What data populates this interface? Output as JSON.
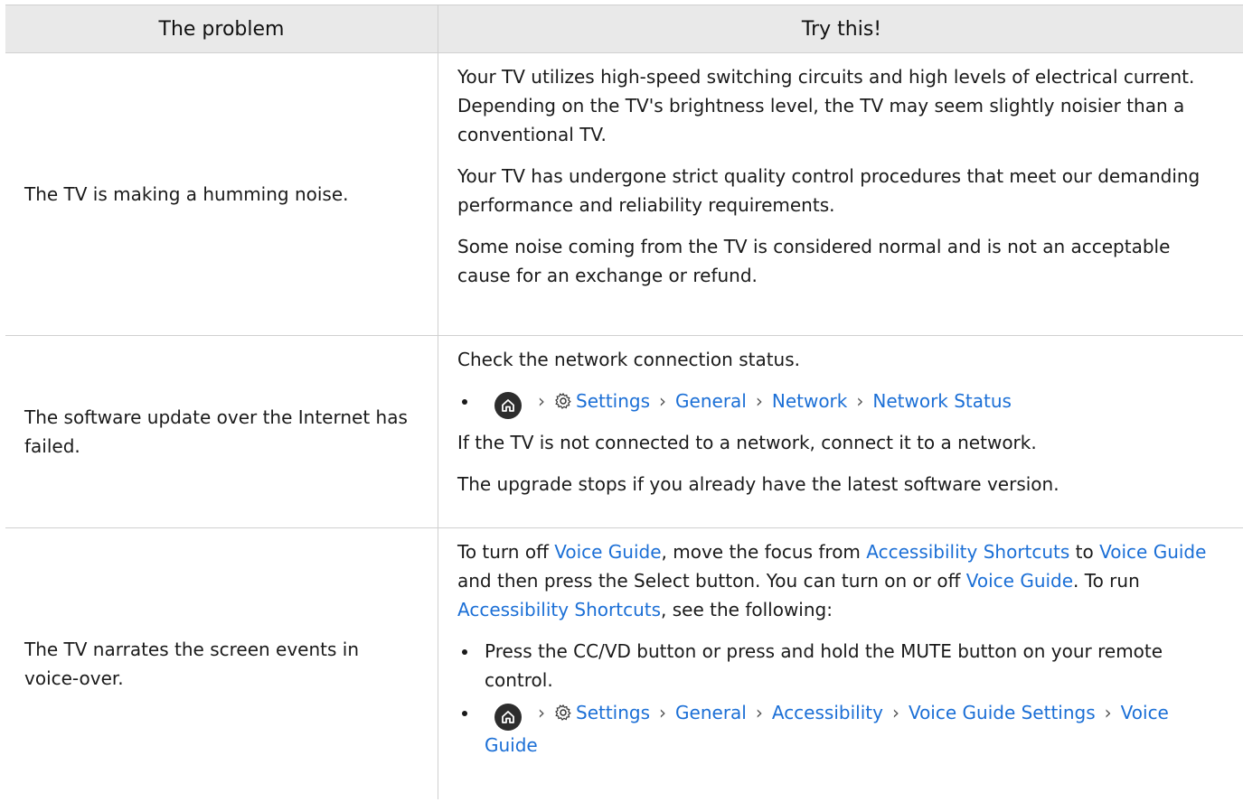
{
  "header": {
    "problem": "The problem",
    "solution": "Try this!"
  },
  "colors": {
    "link": "#1b6fd6",
    "header_bg": "#e9e9e9",
    "border": "#d0d0d0"
  },
  "rows": [
    {
      "problem": "The TV is making a humming noise.",
      "paragraphs": [
        "Your TV utilizes high-speed switching circuits and high levels of electrical current. Depending on the TV's brightness level, the TV may seem slightly noisier than a conventional TV.",
        "Your TV has undergone strict quality control procedures that meet our demanding performance and reliability requirements.",
        "Some noise coming from the TV is considered normal and is not an acceptable cause for an exchange or refund."
      ]
    },
    {
      "problem": "The software update over the Internet has failed.",
      "intro": "Check the network connection status.",
      "path": [
        "Settings",
        "General",
        "Network",
        "Network Status"
      ],
      "paragraphs": [
        "If the TV is not connected to a network, connect it to a network.",
        "The upgrade stops if you already have the latest software version."
      ]
    },
    {
      "problem": "The TV narrates the screen events in voice-over.",
      "intro_parts": {
        "t1": "To turn off ",
        "l1": "Voice Guide",
        "t2": ", move the focus from ",
        "l2": "Accessibility Shortcuts",
        "t3": " to ",
        "l3": "Voice Guide",
        "t4": " and then press the Select button. You can turn on or off ",
        "l4": "Voice Guide",
        "t5": ". To run ",
        "l5": "Accessibility Shortcuts",
        "t6": ", see the following:"
      },
      "bullet1": "Press the CC/VD button or press and hold the MUTE button on your remote control.",
      "path": [
        "Settings",
        "General",
        "Accessibility",
        "Voice Guide Settings",
        "Voice Guide"
      ]
    }
  ],
  "icons": {
    "home": "home-icon",
    "settings": "gear-icon",
    "separator": "chevron-right-icon"
  }
}
